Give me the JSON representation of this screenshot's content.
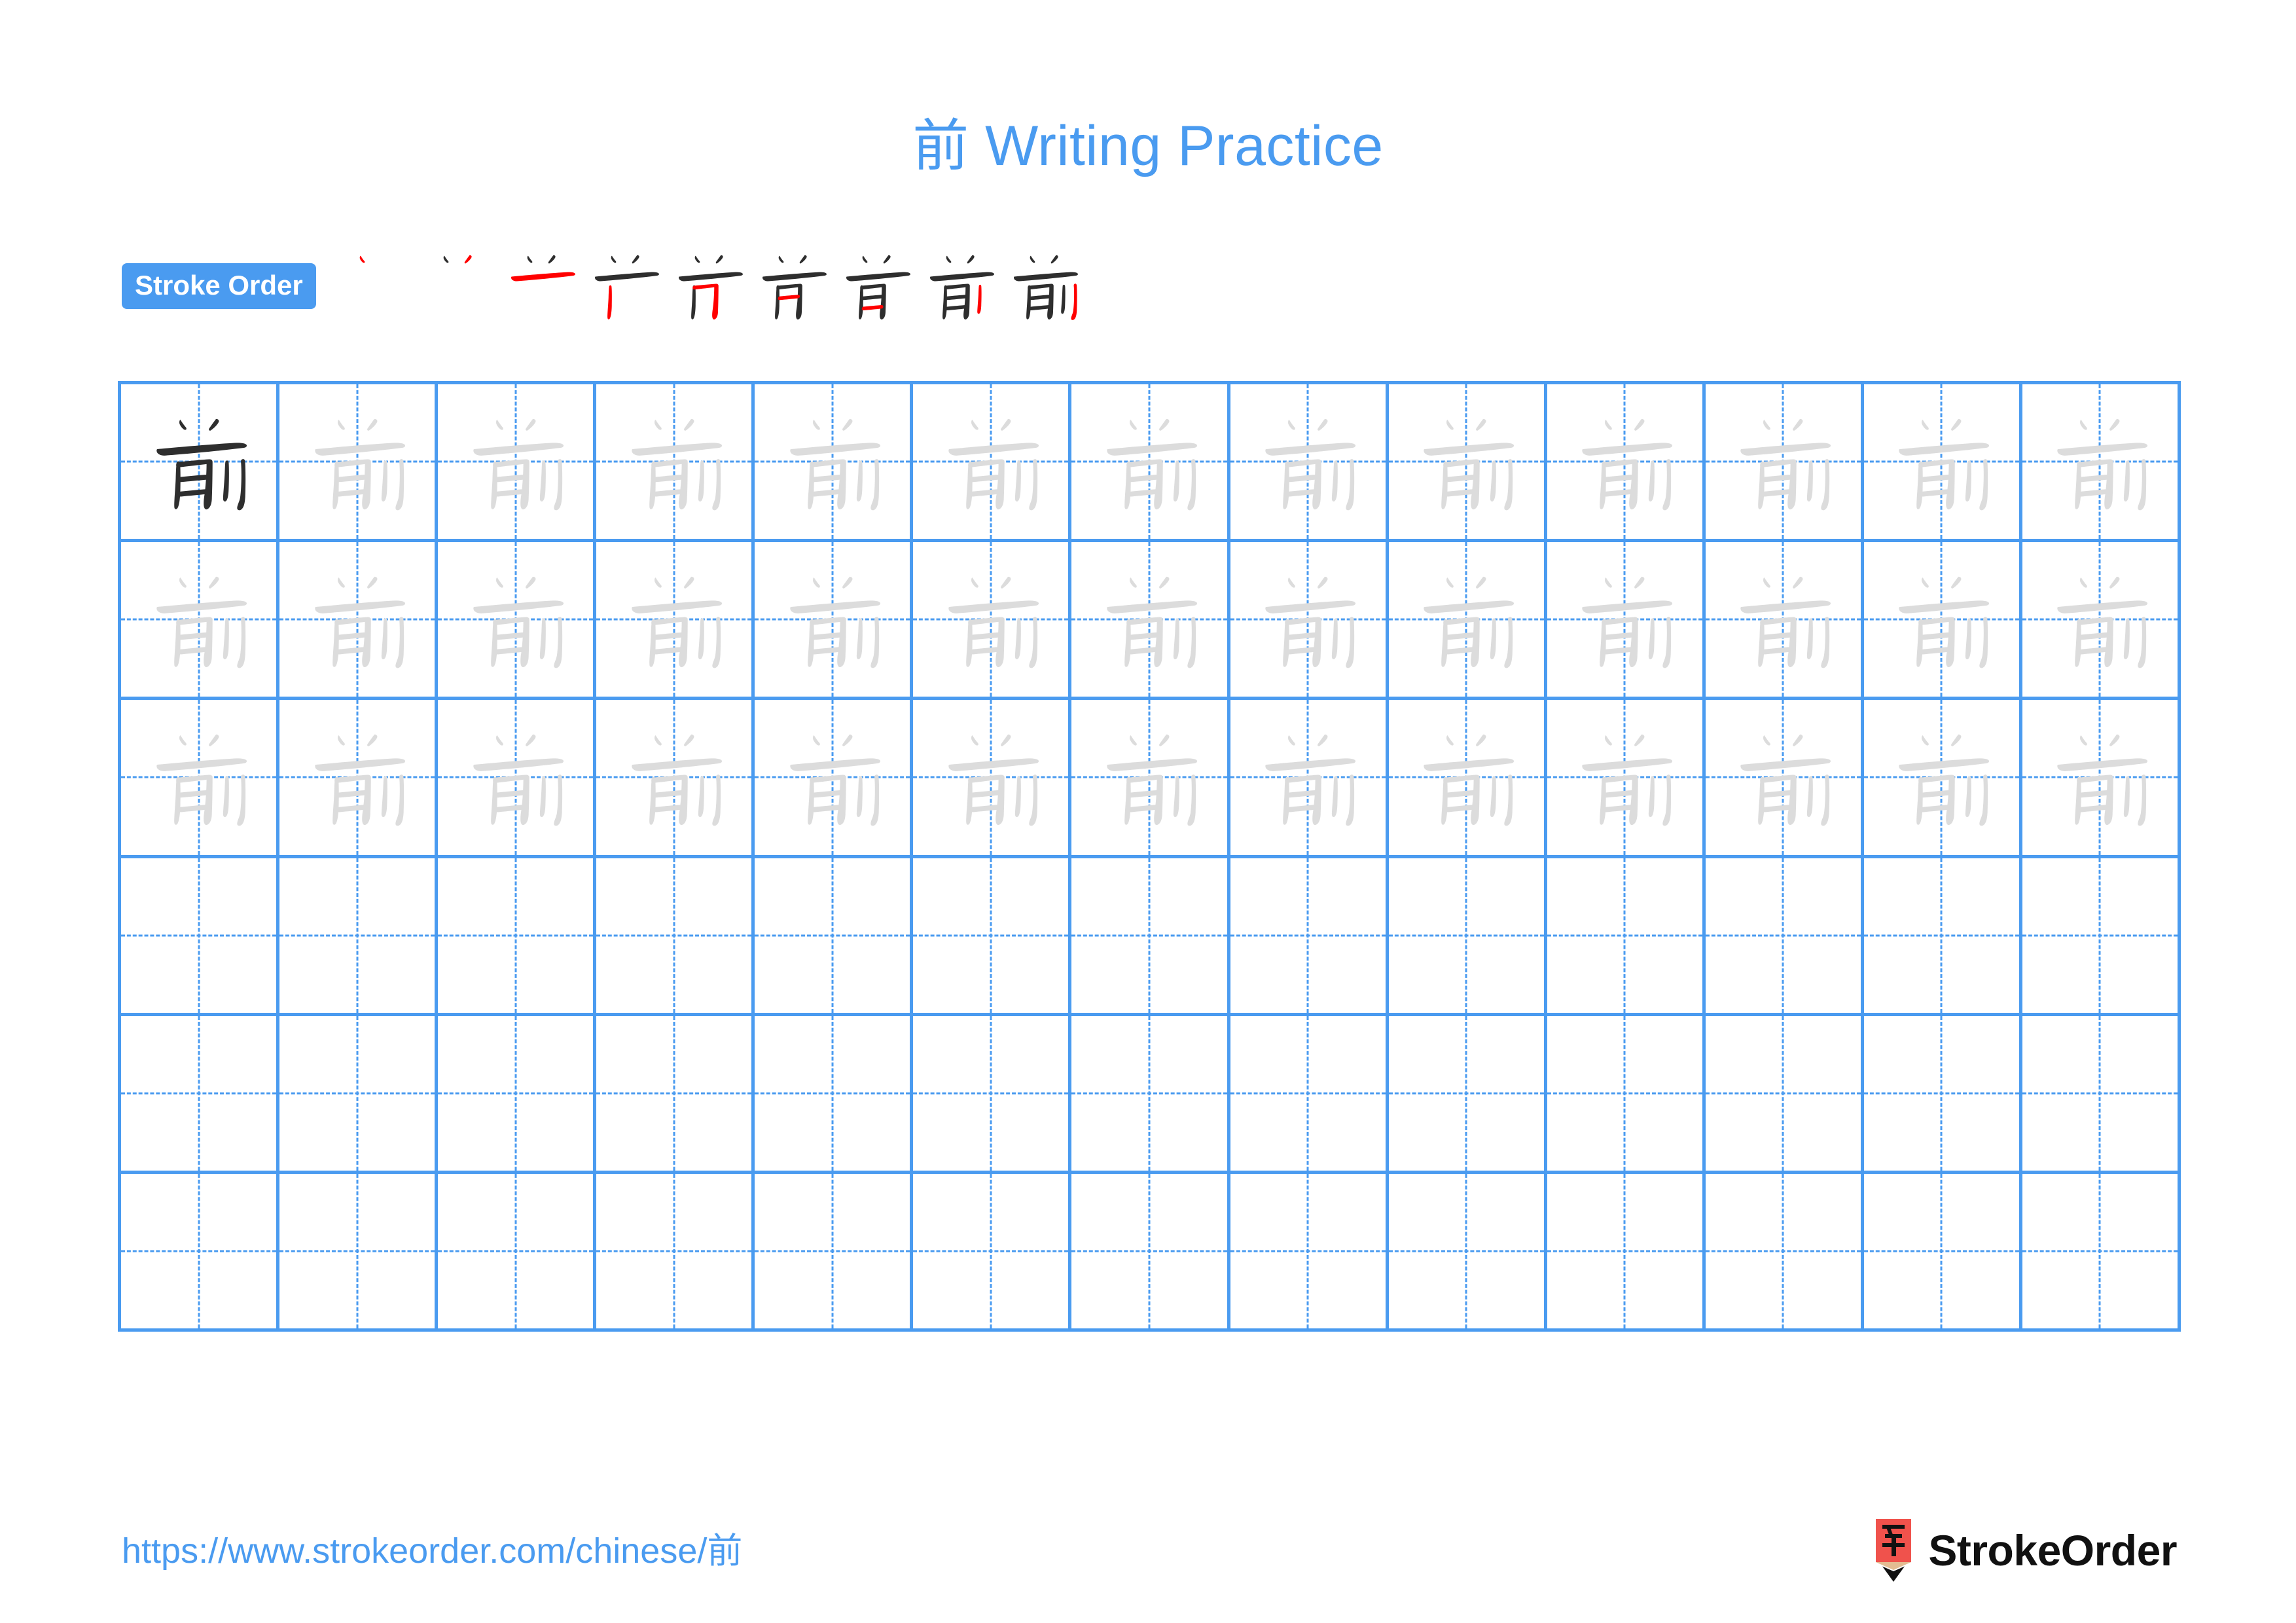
{
  "page": {
    "title": "前 Writing Practice",
    "character": "前",
    "background_color": "#FFFFFF",
    "accent_color": "#4A9BF0"
  },
  "stroke_order": {
    "badge_label": "Stroke Order",
    "badge_bg": "#4A9BF0",
    "badge_text_color": "#FFFFFF",
    "new_stroke_color": "#FF0000",
    "existing_stroke_color": "#2E2E2E",
    "total_strokes": 9,
    "steps": [
      {
        "index": 1,
        "strokes_shown": 1,
        "new_stroke": 1
      },
      {
        "index": 2,
        "strokes_shown": 2,
        "new_stroke": 2
      },
      {
        "index": 3,
        "strokes_shown": 3,
        "new_stroke": 3
      },
      {
        "index": 4,
        "strokes_shown": 4,
        "new_stroke": 4
      },
      {
        "index": 5,
        "strokes_shown": 5,
        "new_stroke": 5
      },
      {
        "index": 6,
        "strokes_shown": 6,
        "new_stroke": 6
      },
      {
        "index": 7,
        "strokes_shown": 7,
        "new_stroke": 7
      },
      {
        "index": 8,
        "strokes_shown": 8,
        "new_stroke": 8
      },
      {
        "index": 9,
        "strokes_shown": 9,
        "new_stroke": 9
      }
    ]
  },
  "practice_grid": {
    "columns": 13,
    "rows": 6,
    "cell_border_color": "#4A9BF0",
    "guide_line_color": "#4A9BF0",
    "model_char_color": "#2E2E2E",
    "trace_char_color": "#DCDCDC",
    "cells": [
      [
        "model",
        "trace",
        "trace",
        "trace",
        "trace",
        "trace",
        "trace",
        "trace",
        "trace",
        "trace",
        "trace",
        "trace",
        "trace"
      ],
      [
        "trace",
        "trace",
        "trace",
        "trace",
        "trace",
        "trace",
        "trace",
        "trace",
        "trace",
        "trace",
        "trace",
        "trace",
        "trace"
      ],
      [
        "trace",
        "trace",
        "trace",
        "trace",
        "trace",
        "trace",
        "trace",
        "trace",
        "trace",
        "trace",
        "trace",
        "trace",
        "trace"
      ],
      [
        "empty",
        "empty",
        "empty",
        "empty",
        "empty",
        "empty",
        "empty",
        "empty",
        "empty",
        "empty",
        "empty",
        "empty",
        "empty"
      ],
      [
        "empty",
        "empty",
        "empty",
        "empty",
        "empty",
        "empty",
        "empty",
        "empty",
        "empty",
        "empty",
        "empty",
        "empty",
        "empty"
      ],
      [
        "empty",
        "empty",
        "empty",
        "empty",
        "empty",
        "empty",
        "empty",
        "empty",
        "empty",
        "empty",
        "empty",
        "empty",
        "empty"
      ]
    ]
  },
  "footer": {
    "url": "https://www.strokeorder.com/chinese/前",
    "url_color": "#4A9BF0",
    "brand_name": "StrokeOrder",
    "logo_glyph": "字",
    "logo_body_color": "#F0524C",
    "logo_wood_color": "#E3BC92",
    "logo_tip_color": "#111111"
  }
}
